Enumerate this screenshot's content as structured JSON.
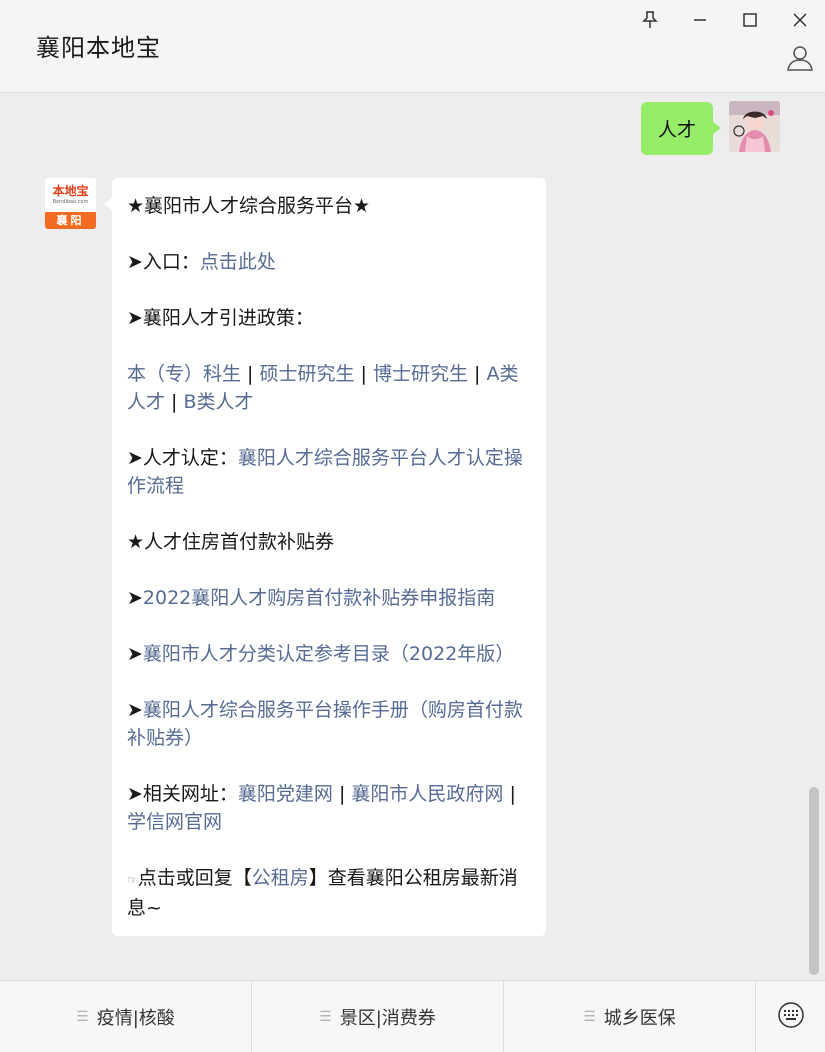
{
  "window": {
    "title": "襄阳本地宝"
  },
  "chat": {
    "user_message": "人才",
    "bot_logo": {
      "line1": "本地宝",
      "line2": "Bendibao.com",
      "line3": "襄阳"
    },
    "bot_message": {
      "heading": "★襄阳市人才综合服务平台★",
      "entry_prefix": "➤入口：",
      "entry_link": "点击此处",
      "policy_heading": "➤襄阳人才引进政策：",
      "policy_links": [
        "本（专）科生",
        "硕士研究生",
        "博士研究生",
        "A类人才",
        "B类人才"
      ],
      "separator": " | ",
      "cert_prefix": "➤人才认定：",
      "cert_link": "襄阳人才综合服务平台人才认定操作流程",
      "housing_heading": "★人才住房首付款补贴券",
      "arrow": "➤",
      "housing_links": [
        "2022襄阳人才购房首付款补贴券申报指南",
        "襄阳市人才分类认定参考目录（2022年版）",
        "襄阳人才综合服务平台操作手册（购房首付款补贴券）"
      ],
      "sites_prefix": "➤相关网址：",
      "sites_links": [
        "襄阳党建网",
        "襄阳市人民政府网",
        "学信网官网"
      ],
      "footer_icon": "☞",
      "footer_pre": "点击或回复【",
      "footer_link": "公租房",
      "footer_post": "】查看襄阳公租房最新消息~"
    }
  },
  "menu": {
    "items": [
      {
        "label": "疫情|核酸",
        "icon": "hamburger-icon"
      },
      {
        "label": "景区|消费券",
        "icon": "hamburger-icon"
      },
      {
        "label": "城乡医保",
        "icon": "hamburger-icon"
      }
    ],
    "ham_glyph": "☰"
  },
  "colors": {
    "link": "#576b95",
    "my_bubble": "#95ec69",
    "logo_orange": "#f26b21",
    "background": "#ededed"
  }
}
